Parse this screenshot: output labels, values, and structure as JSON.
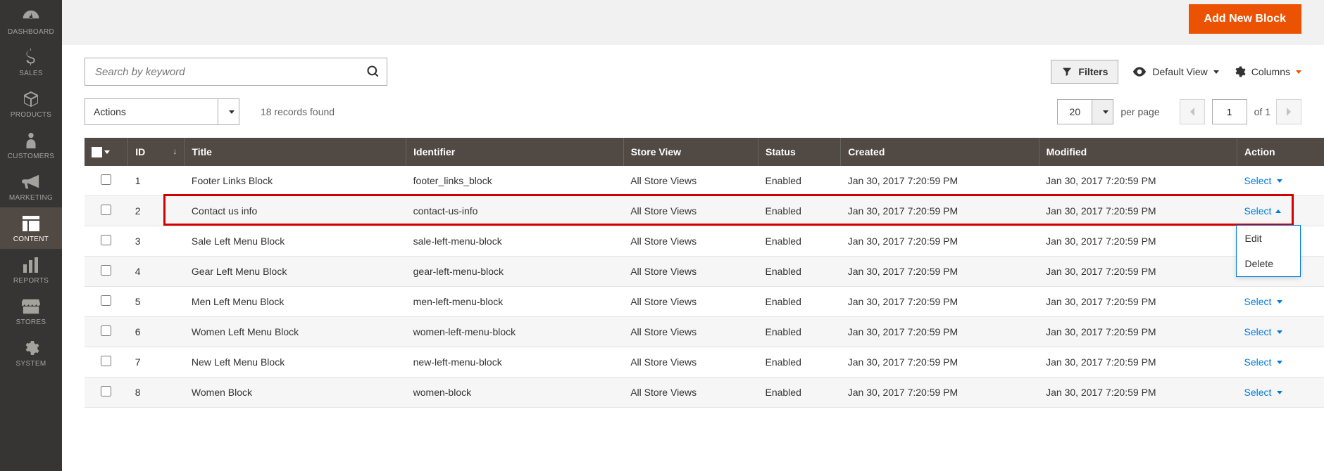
{
  "sidebar": {
    "items": [
      {
        "label": "DASHBOARD",
        "icon": "gauge"
      },
      {
        "label": "SALES",
        "icon": "dollar"
      },
      {
        "label": "PRODUCTS",
        "icon": "cube"
      },
      {
        "label": "CUSTOMERS",
        "icon": "person"
      },
      {
        "label": "MARKETING",
        "icon": "megaphone"
      },
      {
        "label": "CONTENT",
        "icon": "layout"
      },
      {
        "label": "REPORTS",
        "icon": "bars"
      },
      {
        "label": "STORES",
        "icon": "storefront"
      },
      {
        "label": "SYSTEM",
        "icon": "gear"
      }
    ],
    "active_index": 5
  },
  "header": {
    "primary_button": "Add New Block"
  },
  "toolbar": {
    "search_placeholder": "Search by keyword",
    "filters_label": "Filters",
    "default_view_label": "Default View",
    "columns_label": "Columns"
  },
  "row2": {
    "actions_label": "Actions",
    "records_found": "18 records found",
    "page_size": "20",
    "per_page": "per page",
    "current_page": "1",
    "of_label": "of",
    "total_pages": "1"
  },
  "table": {
    "columns": [
      "",
      "ID",
      "Title",
      "Identifier",
      "Store View",
      "Status",
      "Created",
      "Modified",
      "Action"
    ],
    "sorted_col": 1,
    "action_label": "Select",
    "rows": [
      {
        "id": "1",
        "title": "Footer Links Block",
        "identifier": "footer_links_block",
        "store_view": "All Store Views",
        "status": "Enabled",
        "created": "Jan 30, 2017 7:20:59 PM",
        "modified": "Jan 30, 2017 7:20:59 PM"
      },
      {
        "id": "2",
        "title": "Contact us info",
        "identifier": "contact-us-info",
        "store_view": "All Store Views",
        "status": "Enabled",
        "created": "Jan 30, 2017 7:20:59 PM",
        "modified": "Jan 30, 2017 7:20:59 PM"
      },
      {
        "id": "3",
        "title": "Sale Left Menu Block",
        "identifier": "sale-left-menu-block",
        "store_view": "All Store Views",
        "status": "Enabled",
        "created": "Jan 30, 2017 7:20:59 PM",
        "modified": "Jan 30, 2017 7:20:59 PM"
      },
      {
        "id": "4",
        "title": "Gear Left Menu Block",
        "identifier": "gear-left-menu-block",
        "store_view": "All Store Views",
        "status": "Enabled",
        "created": "Jan 30, 2017 7:20:59 PM",
        "modified": "Jan 30, 2017 7:20:59 PM"
      },
      {
        "id": "5",
        "title": "Men Left Menu Block",
        "identifier": "men-left-menu-block",
        "store_view": "All Store Views",
        "status": "Enabled",
        "created": "Jan 30, 2017 7:20:59 PM",
        "modified": "Jan 30, 2017 7:20:59 PM"
      },
      {
        "id": "6",
        "title": "Women Left Menu Block",
        "identifier": "women-left-menu-block",
        "store_view": "All Store Views",
        "status": "Enabled",
        "created": "Jan 30, 2017 7:20:59 PM",
        "modified": "Jan 30, 2017 7:20:59 PM"
      },
      {
        "id": "7",
        "title": "New Left Menu Block",
        "identifier": "new-left-menu-block",
        "store_view": "All Store Views",
        "status": "Enabled",
        "created": "Jan 30, 2017 7:20:59 PM",
        "modified": "Jan 30, 2017 7:20:59 PM"
      },
      {
        "id": "8",
        "title": "Women Block",
        "identifier": "women-block",
        "store_view": "All Store Views",
        "status": "Enabled",
        "created": "Jan 30, 2017 7:20:59 PM",
        "modified": "Jan 30, 2017 7:20:59 PM"
      }
    ],
    "highlighted_row_index": 1,
    "open_dropdown_row_index": 1,
    "dropdown_items": [
      "Edit",
      "Delete"
    ]
  }
}
